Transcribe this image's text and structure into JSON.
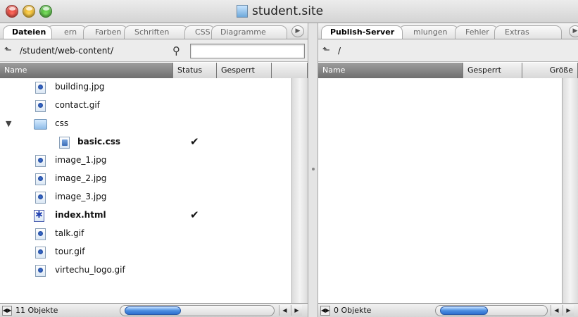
{
  "window": {
    "title": "student.site",
    "icon": "site-document-icon"
  },
  "left": {
    "tabs": [
      {
        "label": "Dateien",
        "active": true
      },
      {
        "label": "ern",
        "active": false
      },
      {
        "label": "Farben",
        "active": false
      },
      {
        "label": "Schriften",
        "active": false
      },
      {
        "label": "CSS",
        "active": false
      },
      {
        "label": "Diagramme",
        "active": false
      }
    ],
    "path": "/student/web-content/",
    "search_value": "",
    "columns": [
      "Name",
      "Status",
      "Gesperrt"
    ],
    "files": [
      {
        "name": "building.jpg",
        "type": "image",
        "bold": false,
        "checked": false,
        "indent": 0
      },
      {
        "name": "contact.gif",
        "type": "image",
        "bold": false,
        "checked": false,
        "indent": 0
      },
      {
        "name": "css",
        "type": "folder",
        "bold": false,
        "checked": false,
        "indent": 0
      },
      {
        "name": "basic.css",
        "type": "css",
        "bold": true,
        "checked": true,
        "indent": 1
      },
      {
        "name": "image_1.jpg",
        "type": "image",
        "bold": false,
        "checked": false,
        "indent": 0
      },
      {
        "name": "image_2.jpg",
        "type": "image",
        "bold": false,
        "checked": false,
        "indent": 0
      },
      {
        "name": "image_3.jpg",
        "type": "image",
        "bold": false,
        "checked": false,
        "indent": 0
      },
      {
        "name": "index.html",
        "type": "html",
        "bold": true,
        "checked": true,
        "indent": 0
      },
      {
        "name": "talk.gif",
        "type": "image",
        "bold": false,
        "checked": false,
        "indent": 0
      },
      {
        "name": "tour.gif",
        "type": "image",
        "bold": false,
        "checked": false,
        "indent": 0
      },
      {
        "name": "virtechu_logo.gif",
        "type": "image",
        "bold": false,
        "checked": false,
        "indent": 0
      }
    ],
    "status_count": "11 Objekte"
  },
  "right": {
    "tabs": [
      {
        "label": "Publish-Server",
        "active": true
      },
      {
        "label": "mlungen",
        "active": false
      },
      {
        "label": "Fehler",
        "active": false
      },
      {
        "label": "Extras",
        "active": false
      }
    ],
    "path": "/",
    "columns": [
      "Name",
      "Gesperrt",
      "Größe"
    ],
    "status_count": "0 Objekte"
  },
  "icons": {
    "checkmark": "✔",
    "disclosure": "▼",
    "up_folder": "⬑",
    "search": "⚲"
  },
  "colors": {
    "selection_blue": "#4a8de0",
    "header_gray": "#8e8e8e"
  }
}
